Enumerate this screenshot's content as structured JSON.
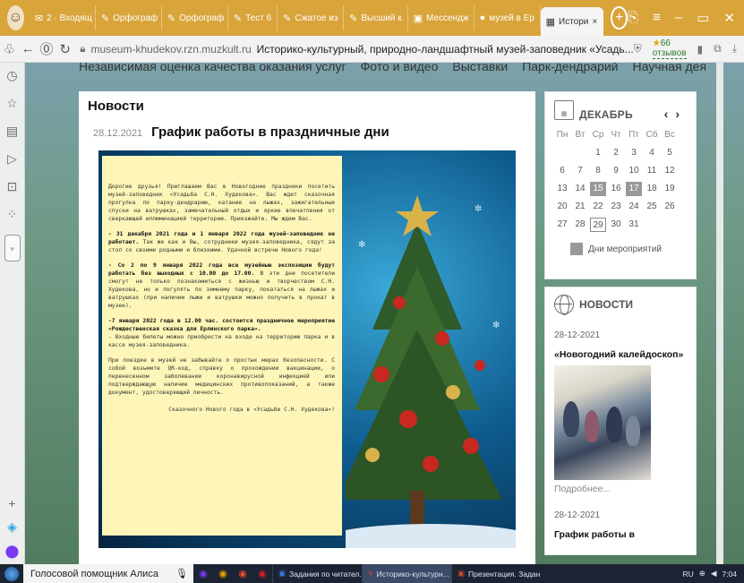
{
  "browser": {
    "tabs": [
      {
        "icon": "✉",
        "label": "2 · Входящ"
      },
      {
        "icon": "✎",
        "label": "Орфограф"
      },
      {
        "icon": "✎",
        "label": "Орфограф"
      },
      {
        "icon": "✎",
        "label": "Тест 6"
      },
      {
        "icon": "✎",
        "label": "Сжатое из"
      },
      {
        "icon": "✎",
        "label": "Высший к"
      },
      {
        "icon": "▣",
        "label": "Мессендж"
      },
      {
        "icon": "●",
        "label": "музей в Ер"
      },
      {
        "icon": "▦",
        "label": "Истори"
      }
    ],
    "url_host": "museum-khudekov.rzn.muzkult.ru",
    "page_title": "Историко-культурный, природно-ландшафтный музей-заповедник «Усадь...",
    "reviews": "66 отзывов"
  },
  "site": {
    "nav": [
      "Независимая оценка качества оказания услуг",
      "Фото и видео",
      "Выставки",
      "Парк-дендрарий",
      "Научная деятельность"
    ]
  },
  "main": {
    "section_title": "Новости",
    "post_date": "28.12.2021",
    "post_title": "График работы в праздничные дни",
    "note": {
      "p1": "Дорогие друзья! Приглашаем Вас в Новогодние праздники посетить музей-заповедник «Усадьба С.Н. Худекова». Вас ждет сказочная прогулка по парку-дендрарию, катание на лыжах, зажигательные спуски на ватрушках, замечательный отдых и яркие впечатления от сверкающей иллюминацией территории. Приезжайте. Мы ждем Вас.",
      "p2_bold": "- 31 декабря 2021 года и 1 января 2022 года музей-заповедник не работает.",
      "p2_rest": " Так же как и Вы, сотрудники музея-заповедника, сядут за стол со своими родными и близкими. Удачной встречи Нового года!",
      "p3_bold": "- Со 2 по 9 января 2022 года все музейные экспозиции будут работать без выходных с 10.00 до 17.00.",
      "p3_rest": " В эти дни посетители смогут не только познакомиться с жизнью и творчеством С.Н. Худекова, но и погулять по зимнему парку, покататься на лыжах и ватрушках (при наличии лыжи и ватрушки можно получить в прокат в музее).",
      "p4_bold": "-7 января 2022 года в 12.00 час. состоится праздничное мероприятие «Рождественская сказка для Ерлинского парка».",
      "p4_rest": "- Входные билеты можно приобрести на входе на территорию парка и в кассе музея-заповедника.",
      "p5": "При поездке в музей не забывайте о простых мерах безопасности. С собой возьмите QR-код, справку о прохождении вакцинации, о перенесенном заболевании коронавирусной инфекцией или подтверждающую наличие медицинских противопоказаний, а также документ, удостоверяющий личность.",
      "sign": "Сказочного Нового года в «Усадьбе С.Н. Худекова»!"
    }
  },
  "calendar": {
    "month": "ДЕКАБРЬ",
    "weekdays": [
      "Пн",
      "Вт",
      "Ср",
      "Чт",
      "Пт",
      "Сб",
      "Вс"
    ],
    "leading_blanks": 2,
    "days": [
      "1",
      "2",
      "3",
      "4",
      "5",
      "6",
      "7",
      "8",
      "9",
      "10",
      "11",
      "12",
      "13",
      "14",
      "15",
      "16",
      "17",
      "18",
      "19",
      "20",
      "21",
      "22",
      "23",
      "24",
      "25",
      "26",
      "27",
      "28",
      "29",
      "30",
      "31"
    ],
    "event_days": [
      "15",
      "17"
    ],
    "today": "29",
    "legend": "Дни мероприятий"
  },
  "news_widget": {
    "heading": "НОВОСТИ",
    "items": [
      {
        "date": "28-12-2021",
        "title": "«Новогодний калейдоскоп»",
        "more": "Подробнее..."
      },
      {
        "date": "28-12-2021",
        "title": "График работы в"
      }
    ]
  },
  "taskbar": {
    "alice": "Голосовой помощник Алиса",
    "apps": [
      "Задания по читател...",
      "Историко-культурн...",
      "Презентация. Задан..."
    ],
    "tray": [
      "RU",
      "7:04"
    ]
  }
}
